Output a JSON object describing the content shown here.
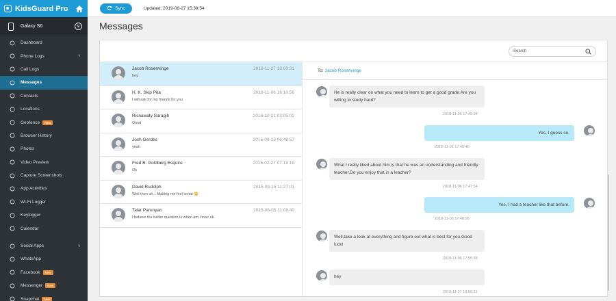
{
  "brand": {
    "name": "KidsGuard Pro"
  },
  "device": {
    "name": "Galaxy S6"
  },
  "nav": [
    {
      "label": "Dashboard",
      "icon": "dashboard-icon"
    },
    {
      "label": "Phone Logs",
      "icon": "phone-logs-icon",
      "caret": "∨"
    },
    {
      "label": "Call Logs",
      "icon": "phone-icon"
    },
    {
      "label": "Messages",
      "icon": "message-icon",
      "active": true
    },
    {
      "label": "Contacts",
      "icon": "contacts-icon"
    },
    {
      "label": "Locations",
      "icon": "location-icon"
    },
    {
      "label": "Geofence",
      "icon": "geofence-icon",
      "badge": "New"
    },
    {
      "label": "Browser History",
      "icon": "browser-icon"
    },
    {
      "label": "Photos",
      "icon": "photo-icon"
    },
    {
      "label": "Video Preview",
      "icon": "video-icon"
    },
    {
      "label": "Capture Screenshots",
      "icon": "screenshot-icon"
    },
    {
      "label": "App Activities",
      "icon": "app-icon"
    },
    {
      "label": "Wi-Fi Logger",
      "icon": "wifi-icon"
    },
    {
      "label": "Keylogger",
      "icon": "keyboard-icon"
    },
    {
      "label": "Calendar",
      "icon": "calendar-icon"
    },
    {
      "label": "Social Apps",
      "icon": "social-icon",
      "caret": "∨"
    },
    {
      "label": "WhatsApp",
      "icon": "whatsapp-icon"
    },
    {
      "label": "Facebook",
      "icon": "facebook-icon",
      "badge": "New"
    },
    {
      "label": "Messenger",
      "icon": "messenger-icon",
      "badge": "New"
    },
    {
      "label": "Snapchat",
      "icon": "snapchat-icon",
      "badge": "New"
    }
  ],
  "topbar": {
    "sync_label": "Sync",
    "updated": "Updated: 2019-08-27 15:39:54"
  },
  "page": {
    "title": "Messages"
  },
  "search": {
    "placeholder": "Search"
  },
  "conversations": [
    {
      "name": "Jacob Rosenvinge",
      "time": "2018-11-27 18:00:31",
      "preview": "hey",
      "active": true
    },
    {
      "name": "H. K. Skip Pita",
      "time": "2018-11-06 16:10:56",
      "preview": "I will ask for my friends for you"
    },
    {
      "name": "Risnawaty Saragih",
      "time": "2016-10-21 03:05:02",
      "preview": "Good"
    },
    {
      "name": "Josh Gerdes",
      "time": "2016-09-13 06:48:57",
      "preview": "yeah"
    },
    {
      "name": "Fred B. Goldberg Esquire",
      "time": "2016-02-27 07:19:19",
      "preview": "Ok"
    },
    {
      "name": "David Rudolph",
      "time": "2015-09-15 11:27:01",
      "preview": "Well then uh... Making me feel loved 😳"
    },
    {
      "name": "Talar Parunyan",
      "time": "2015-06-05 11:09:40",
      "preview": "I believe the better question is when am I ever ok."
    }
  ],
  "thread": {
    "to_label": "To:",
    "to_name": "Jacob Rosenvinge",
    "messages": [
      {
        "dir": "in",
        "text": "He is really clear on what you need to learn to get a good grade.Are you willing to study hard?",
        "time": "2018-11-06 17:45:34"
      },
      {
        "dir": "out",
        "text": "Yes, I guess so.",
        "time": "2018-11-06 17:45:46"
      },
      {
        "dir": "in",
        "text": "What I really liked about him is that he was an understanding and friendly teacher.Do you enjoy that in a leacher?",
        "time": "2018-11-06 17:47:54"
      },
      {
        "dir": "out",
        "text": "Yes, I had a teacher like that before.",
        "time": "2018-11-06 17:48:06"
      },
      {
        "dir": "in",
        "text": "Well,take a look at everything and figure out what is best for you.Good luck!",
        "time": "2018-11-06 17:50:38"
      },
      {
        "dir": "in",
        "text": "hey",
        "time": "2018-11-27 18:00:31"
      }
    ]
  },
  "colors": {
    "accent": "#1d9bd6",
    "sidebar": "#2e3338",
    "active_nav": "#1e6e92",
    "badge": "#e58a3a",
    "out_bubble": "#b8e9f9"
  }
}
